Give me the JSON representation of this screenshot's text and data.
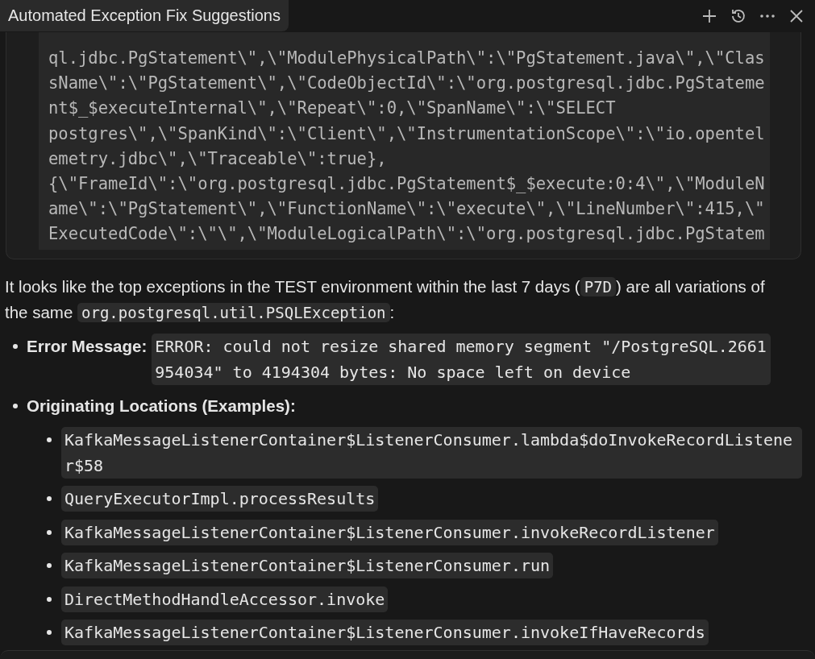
{
  "window": {
    "title": "Automated Exception Fix Suggestions"
  },
  "code_block": {
    "lines": [
      "ql.jdbc.PgStatement\\\",\\\"ModulePhysicalPath\\\":\\\"PgStatement.java\\\",\\\"Clas",
      "sName\\\":\\\"PgStatement\\\",\\\"CodeObjectId\\\":\\\"org.postgresql.jdbc.PgStateme",
      "nt$_$executeInternal\\\",\\\"Repeat\\\":0,\\\"SpanName\\\":\\\"SELECT",
      "postgres\\\",\\\"SpanKind\\\":\\\"Client\\\",\\\"InstrumentationScope\\\":\\\"io.opentel",
      "emetry.jdbc\\\",\\\"Traceable\\\":true},",
      "{\\\"FrameId\\\":\\\"org.postgresql.jdbc.PgStatement$_$execute:0:4\\\",\\\"ModuleN",
      "ame\\\":\\\"PgStatement\\\",\\\"FunctionName\\\":\\\"execute\\\",\\\"LineNumber\\\":415,\\\"",
      "ExecutedCode\\\":\\\"\\\",\\\"ModuleLogicalPath\\\":\\\"org.postgresql.jdbc.PgStatem"
    ]
  },
  "message": {
    "parts": [
      {
        "kind": "text",
        "text": "It looks like the top exceptions in the TEST environment within the last 7 days ("
      },
      {
        "kind": "code",
        "text": "P7D"
      },
      {
        "kind": "text",
        "text": ") are all variations of the same "
      },
      {
        "kind": "code",
        "text": "org.postgresql.util.PSQLException"
      },
      {
        "kind": "text",
        "text": ":"
      }
    ]
  },
  "bullets": [
    {
      "label": "Error Message:",
      "code": "ERROR: could not resize shared memory segment \"/PostgreSQL.2661954034\" to 4194304 bytes: No space left on device"
    },
    {
      "label": "Originating Locations (Examples):",
      "children": [
        "KafkaMessageListenerContainer$ListenerConsumer.lambda$doInvokeRecordListener$58",
        "QueryExecutorImpl.processResults",
        "KafkaMessageListenerContainer$ListenerConsumer.invokeRecordListener",
        "KafkaMessageListenerContainer$ListenerConsumer.run",
        "DirectMethodHandleAccessor.invoke",
        "KafkaMessageListenerContainer$ListenerConsumer.invokeIfHaveRecords"
      ]
    }
  ]
}
